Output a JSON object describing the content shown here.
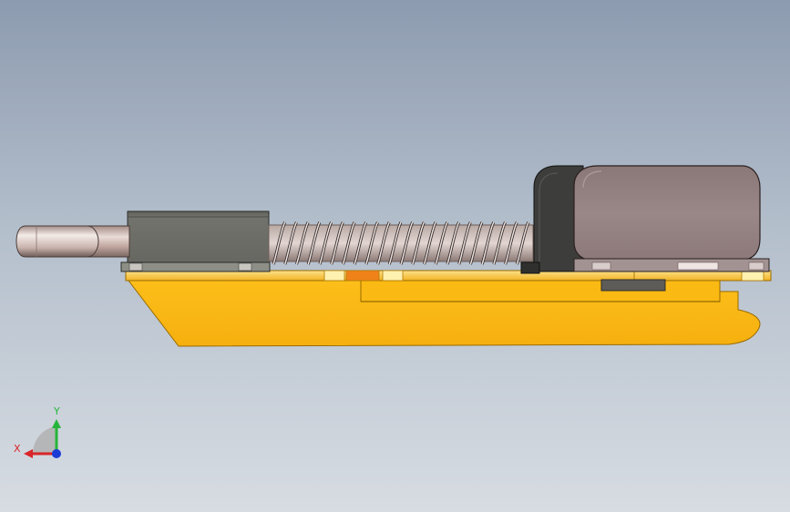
{
  "triad": {
    "x_label": "X",
    "y_label": "Y",
    "x_color": "#d8262a",
    "y_color": "#25b53a",
    "z_color": "#1a3bd6"
  },
  "model": {
    "base_color": "#fbba13",
    "base_edge_color": "#b07c05",
    "block_color": "#6c6d66",
    "motor_color": "#948181",
    "motor_bracket_color": "#3a3a3a",
    "rod_color": "#cbb0a8",
    "spring_color": "#c0c0c0",
    "accent_color": "#f08a1a"
  }
}
